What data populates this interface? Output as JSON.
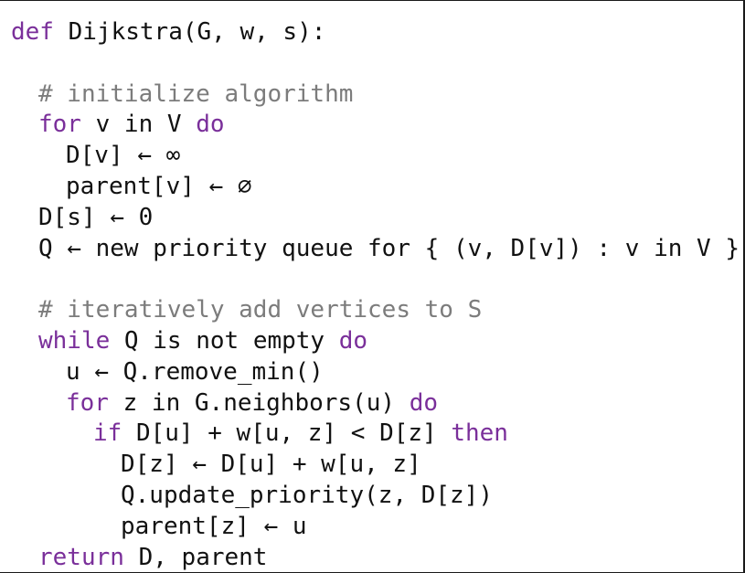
{
  "code": {
    "lines": [
      {
        "indent": 0,
        "tokens": [
          {
            "t": "def",
            "kw": true
          },
          {
            "t": " Dijkstra(G, w, s):"
          }
        ]
      },
      {
        "indent": 0,
        "tokens": []
      },
      {
        "indent": 1,
        "tokens": [
          {
            "t": "# initialize algorithm",
            "comment": true
          }
        ]
      },
      {
        "indent": 1,
        "tokens": [
          {
            "t": "for",
            "kw": true
          },
          {
            "t": " v in V "
          },
          {
            "t": "do",
            "kw": true
          }
        ]
      },
      {
        "indent": 2,
        "tokens": [
          {
            "t": "D[v] ← ∞"
          }
        ]
      },
      {
        "indent": 2,
        "tokens": [
          {
            "t": "parent[v] ← ∅"
          }
        ]
      },
      {
        "indent": 1,
        "tokens": [
          {
            "t": "D[s] ← 0"
          }
        ]
      },
      {
        "indent": 1,
        "tokens": [
          {
            "t": "Q ← new priority queue for { (v, D[v]) : v in V }"
          }
        ]
      },
      {
        "indent": 0,
        "tokens": []
      },
      {
        "indent": 1,
        "tokens": [
          {
            "t": "# iteratively add vertices to S",
            "comment": true
          }
        ]
      },
      {
        "indent": 1,
        "tokens": [
          {
            "t": "while",
            "kw": true
          },
          {
            "t": " Q is not empty "
          },
          {
            "t": "do",
            "kw": true
          }
        ]
      },
      {
        "indent": 2,
        "tokens": [
          {
            "t": "u ← Q.remove_min()"
          }
        ]
      },
      {
        "indent": 2,
        "tokens": [
          {
            "t": "for",
            "kw": true
          },
          {
            "t": " z in G.neighbors(u) "
          },
          {
            "t": "do",
            "kw": true
          }
        ]
      },
      {
        "indent": 3,
        "tokens": [
          {
            "t": "if",
            "kw": true
          },
          {
            "t": " D[u] + w[u, z] < D[z] "
          },
          {
            "t": "then",
            "kw": true
          }
        ]
      },
      {
        "indent": 4,
        "tokens": [
          {
            "t": "D[z] ← D[u] + w[u, z]"
          }
        ]
      },
      {
        "indent": 4,
        "tokens": [
          {
            "t": "Q.update_priority(z, D[z])"
          }
        ]
      },
      {
        "indent": 4,
        "tokens": [
          {
            "t": "parent[z] ← u"
          }
        ]
      },
      {
        "indent": 1,
        "tokens": [
          {
            "t": "return",
            "kw": true
          },
          {
            "t": " D, parent"
          }
        ]
      }
    ]
  },
  "colors": {
    "keyword": "#7a2f9a",
    "comment": "#7c7c7c",
    "text": "#111111",
    "background": "#ffffff"
  }
}
